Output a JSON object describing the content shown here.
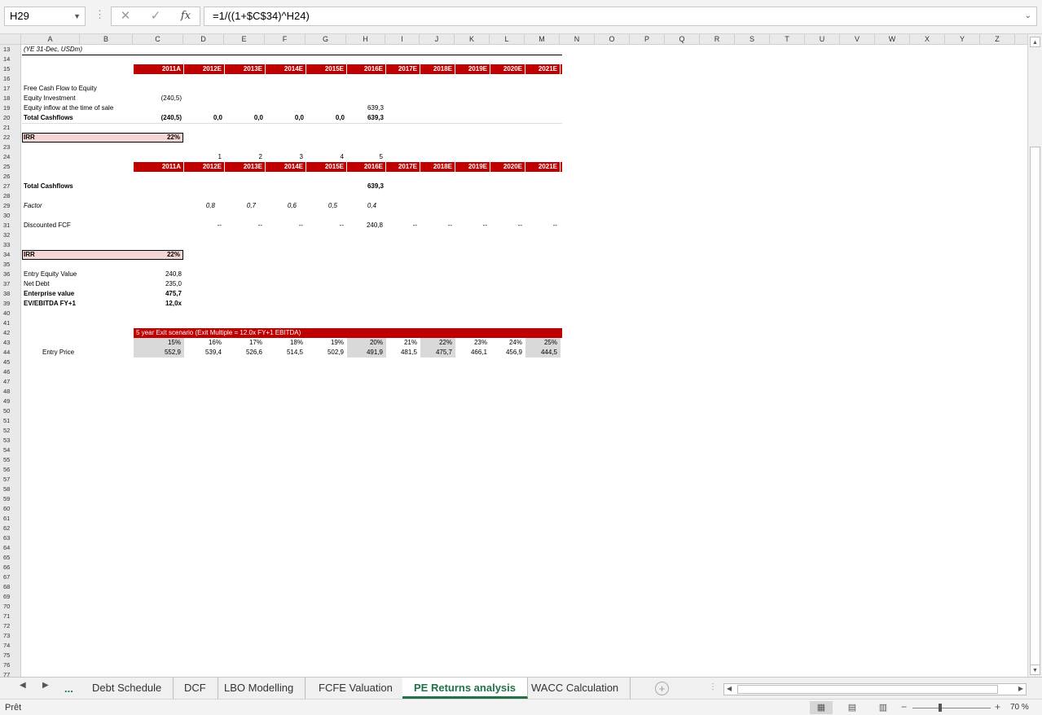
{
  "formula_bar": {
    "name_box": "H29",
    "cancel_icon": "✕",
    "enter_icon": "✓",
    "fx_label": "fx",
    "formula": "=1/((1+$C$34)^H24)"
  },
  "columns": [
    "A",
    "B",
    "C",
    "D",
    "E",
    "F",
    "G",
    "H",
    "I",
    "J",
    "K",
    "L",
    "M",
    "N",
    "O",
    "P",
    "Q",
    "R",
    "S",
    "T",
    "U",
    "V",
    "W",
    "X",
    "Y",
    "Z"
  ],
  "rows_start": 13,
  "rows_end": 77,
  "sheet": {
    "r13_label": "(YE 31-Dec, USDm)",
    "years": [
      "2011A",
      "2012E",
      "2013E",
      "2014E",
      "2015E",
      "2016E",
      "2017E",
      "2018E",
      "2019E",
      "2020E",
      "2021E"
    ],
    "r17_label": "Free Cash Flow to Equity",
    "r18_label": "Equity Investment",
    "r18_c": "(240,5)",
    "r19_label": "Equity inflow at the time of sale",
    "r19_h": "639,3",
    "r20_label": "Total Cashflows",
    "r20_c": "(240,5)",
    "r20_d": "0,0",
    "r20_e": "0,0",
    "r20_f": "0,0",
    "r20_g": "0,0",
    "r20_h": "639,3",
    "r22_label": "IRR",
    "r22_c": "22%",
    "r24": [
      "1",
      "2",
      "3",
      "4",
      "5"
    ],
    "r27_label": "Total Cashflows",
    "r27_h": "639,3",
    "r29_label": "Factor",
    "r29_vals": [
      "0,8",
      "0,7",
      "0,6",
      "0,5",
      "0,4"
    ],
    "r31_label": "Discounted FCF",
    "r31_vals": [
      "--",
      "--",
      "--",
      "--",
      "240,8",
      "--",
      "--",
      "--",
      "--",
      "--"
    ],
    "r34_label": "IRR",
    "r34_c": "22%",
    "r36_label": "Entry Equity Value",
    "r36_c": "240,8",
    "r37_label": "Net Debt",
    "r37_c": "235,0",
    "r38_label": "Enterprise value",
    "r38_c": "475,7",
    "r39_label": "EV/EBITDA FY+1",
    "r39_c": "12,0x",
    "r42_label": "5 year Exit scenario (Exit Multiple = 12.0x FY+1 EBITDA)",
    "r43_vals": [
      "15%",
      "16%",
      "17%",
      "18%",
      "19%",
      "20%",
      "21%",
      "22%",
      "23%",
      "24%",
      "25%"
    ],
    "r44_label": "Entry Price",
    "r44_vals": [
      "552,9",
      "539,4",
      "526,6",
      "514,5",
      "502,9",
      "491,9",
      "481,5",
      "475,7",
      "466,1",
      "456,9",
      "444,5"
    ]
  },
  "tabs": {
    "ellipsis": "...",
    "items": [
      "Debt Schedule",
      "DCF",
      "LBO Modelling",
      "FCFE Valuation",
      "PE Returns analysis",
      "WACC Calculation"
    ],
    "active": "PE Returns analysis"
  },
  "status": {
    "text": "Prêt",
    "zoom": "70 %"
  }
}
